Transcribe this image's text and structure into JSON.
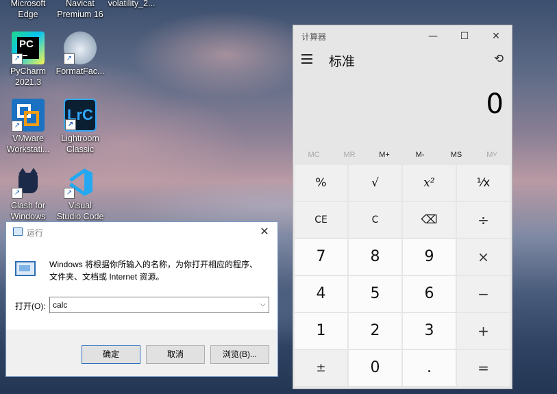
{
  "desktop": {
    "icons": [
      {
        "label_line1": "Microsoft",
        "label_line2": "Edge"
      },
      {
        "label_line1": "Navicat",
        "label_line2": "Premium 16"
      },
      {
        "label_line1": "volatility_2...",
        "label_line2": ""
      },
      {
        "label_line1": "PyCharm",
        "label_line2": "2021.3",
        "glyph": "PC"
      },
      {
        "label_line1": "FormatFac...",
        "label_line2": ""
      },
      {
        "label_line1": "VMware",
        "label_line2": "Workstati..."
      },
      {
        "label_line1": "Lightroom",
        "label_line2": "Classic",
        "glyph": "LrC"
      },
      {
        "label_line1": "Clash for",
        "label_line2": "Windows"
      },
      {
        "label_line1": "Visual",
        "label_line2": "Studio Code"
      }
    ],
    "shortcut_glyph": "↗"
  },
  "run_dialog": {
    "title": "运行",
    "close": "✕",
    "description": "Windows 将根据你所输入的名称，为你打开相应的程序、文件夹、文档或 Internet 资源。",
    "open_label": "打开(O):",
    "input_value": "calc",
    "dropdown_arrow": "⌵",
    "ok": "确定",
    "cancel": "取消",
    "browse": "浏览(B)..."
  },
  "calculator": {
    "window_title": "计算器",
    "minimize": "—",
    "maximize": "☐",
    "close": "✕",
    "mode": "标准",
    "menu_icon": "hamburger-icon",
    "history_glyph": "⟲",
    "display": "0",
    "memory": [
      "MC",
      "MR",
      "M+",
      "M-",
      "MS",
      "M˅"
    ],
    "keys": [
      [
        "%",
        "√",
        "x²",
        "¹⁄x"
      ],
      [
        "CE",
        "C",
        "⌫",
        "÷"
      ],
      [
        "7",
        "8",
        "9",
        "×"
      ],
      [
        "4",
        "5",
        "6",
        "−"
      ],
      [
        "1",
        "2",
        "3",
        "+"
      ],
      [
        "±",
        "0",
        ".",
        "="
      ]
    ]
  }
}
